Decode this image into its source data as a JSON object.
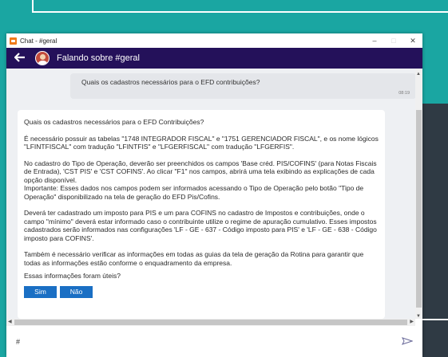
{
  "window": {
    "title": "Chat - #geral",
    "minimize_icon": "minimize-icon",
    "maximize_icon": "maximize-icon",
    "close_icon": "close-icon",
    "minimize_glyph": "–",
    "maximize_glyph": "□",
    "close_glyph": "✕"
  },
  "header": {
    "back_glyph": "🡐",
    "title": "Falando sobre #geral",
    "avatar_icon": "user-avatar-icon"
  },
  "messages": {
    "user": {
      "text": "Quais os cadastros necessários para o EFD contribuições?",
      "time": "08:19"
    },
    "bot": {
      "paragraphs": [
        "Quais os cadastros necessários para o EFD Contribuições?",
        "É necessário possuir as tabelas \"1748 INTEGRADOR FISCAL\" e \"1751 GERENCIADOR FISCAL\",  e os nome lógicos \"LFINTFISCAL\" com tradução \"LFINTFIS\" e \"LFGERFISCAL\" com tradução \"LFGERFIS\".",
        "No cadastro do Tipo de Operação, deverão ser preenchidos os campos 'Base créd. PIS/COFINS' (para Notas Fiscais de Entrada), 'CST PIS' e 'CST COFINS'. Ao clicar \"F1\" nos campos, abrirá uma tela exibindo as explicações de cada opção disponível.\nImportante: Esses dados nos campos podem ser informados acessando o Tipo de Operação pelo botão \"Tipo de Operação\" disponibilizado na tela de geração do EFD Pis/Cofins.",
        "Deverá ter cadastrado um imposto para PIS e um para COFINS no cadastro de Impostos e contribuições, onde o campo \"mínimo\" deverá estar informado caso o contribuinte utilize o regime de apuração cumulativo.  Esses impostos cadastrados serão informados nas configurações 'LF - GE - 637 - Código imposto para PIS' e 'LF - GE - 638 - Código imposto para COFINS'.",
        "Também é necessário verificar as informações em todas as guias da tela de geração da Rotina para garantir que todas as informações estão conforme o enquadramento da empresa."
      ],
      "feedback_question": "Essas informações foram úteis?",
      "yes_label": "Sim",
      "no_label": "Não"
    }
  },
  "input": {
    "value": "#",
    "placeholder": "",
    "send_icon": "send-icon"
  },
  "colors": {
    "header_bg": "#24115a",
    "button_bg": "#1a6fc4",
    "background_teal": "#1aa6a2",
    "app_icon": "#f07a1a"
  }
}
